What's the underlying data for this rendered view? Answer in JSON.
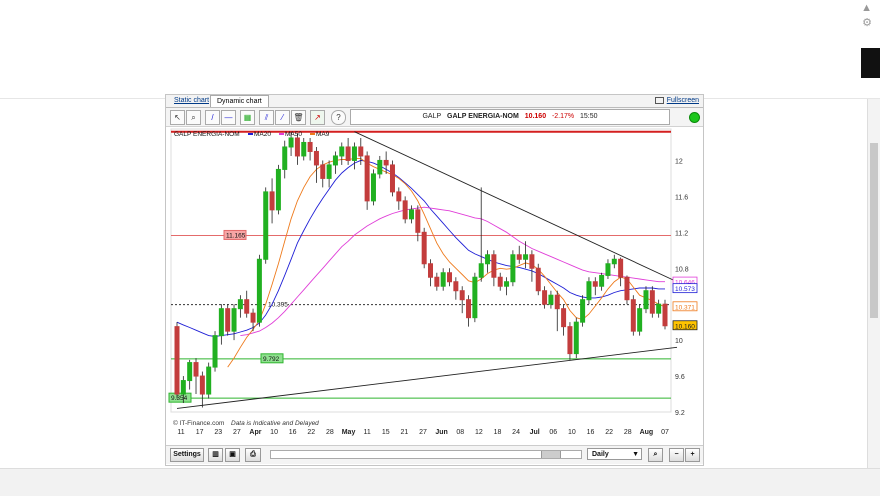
{
  "page": {
    "scroll_up_glyph": "▲",
    "settings_glyph": "⚙"
  },
  "tabs": [
    {
      "label": "Static chart"
    },
    {
      "label": "Dynamic chart"
    }
  ],
  "fullscreen_label": "Fullscreen",
  "toolbar": {
    "ticker_symbol": "GALP",
    "ticker_name": "GALP ENERGIA-NOM",
    "ticker_price": "10.160",
    "ticker_change": "-2.17%",
    "ticker_time": "15:50",
    "icons": [
      "cursor-icon",
      "zoom-icon",
      "line-draw-icon",
      "horizontal-line-icon",
      "fibonacci-icon",
      "channel-icon",
      "delete-icon",
      "indicator-icon",
      "help-icon"
    ]
  },
  "legend": {
    "instrument": "GALP ENERGIA-NOM",
    "items": [
      {
        "label": "MA20",
        "color": "#1f1fd6"
      },
      {
        "label": "MA50",
        "color": "#e03ed8"
      },
      {
        "label": "MA9",
        "color": "#ee7a1c"
      }
    ]
  },
  "footer": {
    "copyright": "© IT-Finance.com",
    "disclaimer": "Data is Indicative and Delayed"
  },
  "bottombar": {
    "settings_label": "Settings",
    "period_label": "Daily",
    "period_arrow": "▼"
  },
  "colors": {
    "up": "#21b021",
    "down": "#c33d3d",
    "ma20": "#1f1fd6",
    "ma50": "#e03ed8",
    "ma9": "#ee7a1c"
  },
  "chart_data": {
    "type": "candlestick",
    "ylim": [
      9.2,
      12.35
    ],
    "y_ticks": [
      "12",
      "11.6",
      "11.2",
      "10.8",
      "10.4",
      "10",
      "9.6",
      "9.2"
    ],
    "x_ticks": [
      "11",
      "17",
      "23",
      "27",
      "Apr",
      "10",
      "16",
      "22",
      "28",
      "May",
      "11",
      "15",
      "21",
      "27",
      "Jun",
      "08",
      "12",
      "18",
      "24",
      "Jul",
      "06",
      "10",
      "16",
      "22",
      "28",
      "Aug",
      "07"
    ],
    "x_tick_bold": [
      "Apr",
      "May",
      "Jun",
      "Jul",
      "Aug"
    ],
    "hlines": [
      {
        "label": "11.165",
        "value": 11.165,
        "color": "#e46b6b"
      },
      {
        "label": "10.395",
        "value": 10.395,
        "color": "#333333"
      },
      {
        "label": "9.792",
        "value": 9.792,
        "color": "#2fb52f"
      },
      {
        "label": "9.354",
        "value": 9.354,
        "color": "#2fb52f"
      }
    ],
    "top_line": 12.32,
    "price_tags": [
      {
        "label": "10.646",
        "value": 10.646,
        "color": "#e03ed8"
      },
      {
        "label": "10.573",
        "value": 10.573,
        "color": "#1f1fd6"
      },
      {
        "label": "10.371",
        "value": 10.371,
        "color": "#ee7a1c"
      },
      {
        "label": "10.160",
        "value": 10.16,
        "color": "#222222"
      }
    ],
    "trendlines": [
      {
        "from": [
          28,
          12.32
        ],
        "to": [
          77,
          10.65
        ]
      },
      {
        "from": [
          0,
          9.24
        ],
        "to": [
          77,
          9.92
        ]
      }
    ],
    "candles": [
      [
        10.15,
        9.4,
        10.2,
        9.35
      ],
      [
        9.4,
        9.55,
        9.6,
        9.3
      ],
      [
        9.55,
        9.75,
        9.78,
        9.45
      ],
      [
        9.75,
        9.6,
        9.8,
        9.4
      ],
      [
        9.6,
        9.4,
        9.65,
        9.25
      ],
      [
        9.4,
        9.7,
        9.75,
        9.35
      ],
      [
        9.7,
        10.05,
        10.1,
        9.65
      ],
      [
        10.05,
        10.35,
        10.4,
        9.95
      ],
      [
        10.35,
        10.1,
        10.4,
        10.05
      ],
      [
        10.1,
        10.35,
        10.4,
        10.0
      ],
      [
        10.35,
        10.45,
        10.5,
        10.25
      ],
      [
        10.45,
        10.3,
        10.55,
        10.25
      ],
      [
        10.3,
        10.2,
        10.35,
        10.1
      ],
      [
        10.2,
        10.9,
        10.95,
        10.15
      ],
      [
        10.9,
        11.65,
        11.7,
        10.85
      ],
      [
        11.65,
        11.45,
        11.8,
        11.3
      ],
      [
        11.45,
        11.9,
        11.95,
        11.4
      ],
      [
        11.9,
        12.15,
        12.22,
        11.8
      ],
      [
        12.15,
        12.25,
        12.32,
        12.05
      ],
      [
        12.25,
        12.05,
        12.3,
        11.95
      ],
      [
        12.05,
        12.2,
        12.25,
        12.0
      ],
      [
        12.2,
        12.1,
        12.25,
        12.0
      ],
      [
        12.1,
        11.95,
        12.15,
        11.75
      ],
      [
        11.95,
        11.8,
        12.0,
        11.7
      ],
      [
        11.8,
        11.95,
        12.0,
        11.7
      ],
      [
        11.95,
        12.05,
        12.1,
        11.85
      ],
      [
        12.05,
        12.15,
        12.2,
        11.95
      ],
      [
        12.15,
        12.0,
        12.25,
        11.95
      ],
      [
        12.0,
        12.15,
        12.2,
        11.9
      ],
      [
        12.15,
        12.05,
        12.25,
        11.95
      ],
      [
        12.05,
        11.55,
        12.1,
        11.45
      ],
      [
        11.55,
        11.85,
        11.9,
        11.5
      ],
      [
        11.85,
        12.0,
        12.05,
        11.8
      ],
      [
        12.0,
        11.95,
        12.1,
        11.85
      ],
      [
        11.95,
        11.65,
        12.0,
        11.6
      ],
      [
        11.65,
        11.55,
        11.7,
        11.45
      ],
      [
        11.55,
        11.35,
        11.6,
        11.3
      ],
      [
        11.35,
        11.45,
        11.5,
        11.3
      ],
      [
        11.45,
        11.2,
        11.5,
        11.1
      ],
      [
        11.2,
        10.85,
        11.25,
        10.8
      ],
      [
        10.85,
        10.7,
        10.9,
        10.6
      ],
      [
        10.7,
        10.6,
        10.75,
        10.55
      ],
      [
        10.6,
        10.75,
        10.8,
        10.55
      ],
      [
        10.75,
        10.65,
        10.8,
        10.6
      ],
      [
        10.65,
        10.55,
        10.7,
        10.45
      ],
      [
        10.55,
        10.45,
        10.6,
        10.3
      ],
      [
        10.45,
        10.25,
        10.5,
        10.15
      ],
      [
        10.25,
        10.7,
        10.75,
        10.2
      ],
      [
        10.7,
        10.85,
        11.7,
        10.65
      ],
      [
        10.85,
        10.95,
        11.0,
        10.75
      ],
      [
        10.95,
        10.7,
        11.0,
        10.6
      ],
      [
        10.7,
        10.6,
        10.75,
        10.55
      ],
      [
        10.6,
        10.65,
        10.7,
        10.5
      ],
      [
        10.65,
        10.95,
        11.0,
        10.6
      ],
      [
        10.95,
        10.9,
        11.05,
        10.85
      ],
      [
        10.9,
        10.95,
        11.1,
        10.8
      ],
      [
        10.95,
        10.8,
        11.0,
        10.65
      ],
      [
        10.8,
        10.55,
        10.85,
        10.5
      ],
      [
        10.55,
        10.4,
        10.6,
        10.35
      ],
      [
        10.4,
        10.5,
        10.55,
        10.35
      ],
      [
        10.5,
        10.35,
        10.55,
        10.1
      ],
      [
        10.35,
        10.15,
        10.4,
        10.05
      ],
      [
        10.15,
        9.85,
        10.2,
        9.78
      ],
      [
        9.85,
        10.2,
        10.25,
        9.8
      ],
      [
        10.2,
        10.45,
        10.5,
        10.15
      ],
      [
        10.45,
        10.65,
        10.7,
        10.4
      ],
      [
        10.65,
        10.6,
        10.7,
        10.5
      ],
      [
        10.6,
        10.72,
        10.75,
        10.55
      ],
      [
        10.72,
        10.85,
        10.9,
        10.68
      ],
      [
        10.85,
        10.9,
        10.95,
        10.8
      ],
      [
        10.9,
        10.7,
        10.92,
        10.6
      ],
      [
        10.7,
        10.45,
        10.72,
        10.4
      ],
      [
        10.45,
        10.1,
        10.5,
        10.05
      ],
      [
        10.1,
        10.35,
        10.4,
        10.05
      ],
      [
        10.35,
        10.55,
        10.6,
        10.3
      ],
      [
        10.55,
        10.3,
        10.6,
        10.25
      ],
      [
        10.3,
        10.4,
        10.45,
        10.25
      ],
      [
        10.4,
        10.16,
        10.45,
        10.12
      ]
    ],
    "series": [
      {
        "name": "MA20",
        "values": [
          10.2,
          10.17,
          10.14,
          10.11,
          10.08,
          10.05,
          10.04,
          10.05,
          10.06,
          10.07,
          10.09,
          10.11,
          10.14,
          10.19,
          10.28,
          10.4,
          10.55,
          10.72,
          10.9,
          11.08,
          11.22,
          11.35,
          11.47,
          11.58,
          11.68,
          11.78,
          11.86,
          11.92,
          11.97,
          12.0,
          11.99,
          11.97,
          11.94,
          11.9,
          11.86,
          11.81,
          11.75,
          11.69,
          11.62,
          11.55,
          11.46,
          11.38,
          11.3,
          11.22,
          11.14,
          11.07,
          11.0,
          10.96,
          10.93,
          10.9,
          10.87,
          10.85,
          10.83,
          10.82,
          10.81,
          10.79,
          10.77,
          10.74,
          10.7,
          10.66,
          10.62,
          10.58,
          10.53,
          10.5,
          10.48,
          10.47,
          10.47,
          10.48,
          10.5,
          10.53,
          10.55,
          10.56,
          10.57,
          10.58,
          10.58,
          10.58,
          10.57,
          10.57
        ]
      },
      {
        "name": "MA50",
        "values": [
          null,
          null,
          null,
          null,
          null,
          null,
          null,
          null,
          null,
          null,
          10.05,
          10.06,
          10.08,
          10.1,
          10.14,
          10.19,
          10.25,
          10.32,
          10.4,
          10.48,
          10.56,
          10.64,
          10.72,
          10.8,
          10.88,
          10.96,
          11.04,
          11.1,
          11.17,
          11.22,
          11.27,
          11.31,
          11.35,
          11.38,
          11.41,
          11.43,
          11.45,
          11.46,
          11.47,
          11.48,
          11.47,
          11.46,
          11.45,
          11.44,
          11.42,
          11.4,
          11.38,
          11.36,
          11.35,
          11.32,
          11.28,
          11.24,
          11.2,
          11.15,
          11.1,
          11.06,
          11.02,
          10.99,
          10.96,
          10.93,
          10.9,
          10.87,
          10.84,
          10.81,
          10.78,
          10.76,
          10.75,
          10.74,
          10.73,
          10.72,
          10.71,
          10.7,
          10.69,
          10.68,
          10.67,
          10.66,
          10.65,
          10.65
        ]
      },
      {
        "name": "MA9",
        "values": [
          null,
          null,
          null,
          null,
          null,
          null,
          null,
          null,
          9.7,
          9.8,
          9.92,
          10.03,
          10.12,
          10.22,
          10.4,
          10.62,
          10.85,
          11.1,
          11.35,
          11.55,
          11.7,
          11.82,
          11.9,
          11.95,
          11.98,
          12.0,
          12.01,
          12.01,
          12.02,
          12.02,
          11.97,
          11.93,
          11.9,
          11.87,
          11.84,
          11.8,
          11.74,
          11.66,
          11.55,
          11.4,
          11.24,
          11.08,
          10.96,
          10.87,
          10.8,
          10.73,
          10.66,
          10.64,
          10.68,
          10.74,
          10.78,
          10.8,
          10.79,
          10.8,
          10.83,
          10.86,
          10.84,
          10.79,
          10.71,
          10.62,
          10.53,
          10.45,
          10.33,
          10.25,
          10.23,
          10.29,
          10.38,
          10.47,
          10.57,
          10.65,
          10.7,
          10.68,
          10.59,
          10.5,
          10.47,
          10.44,
          10.4,
          10.37
        ]
      }
    ]
  }
}
